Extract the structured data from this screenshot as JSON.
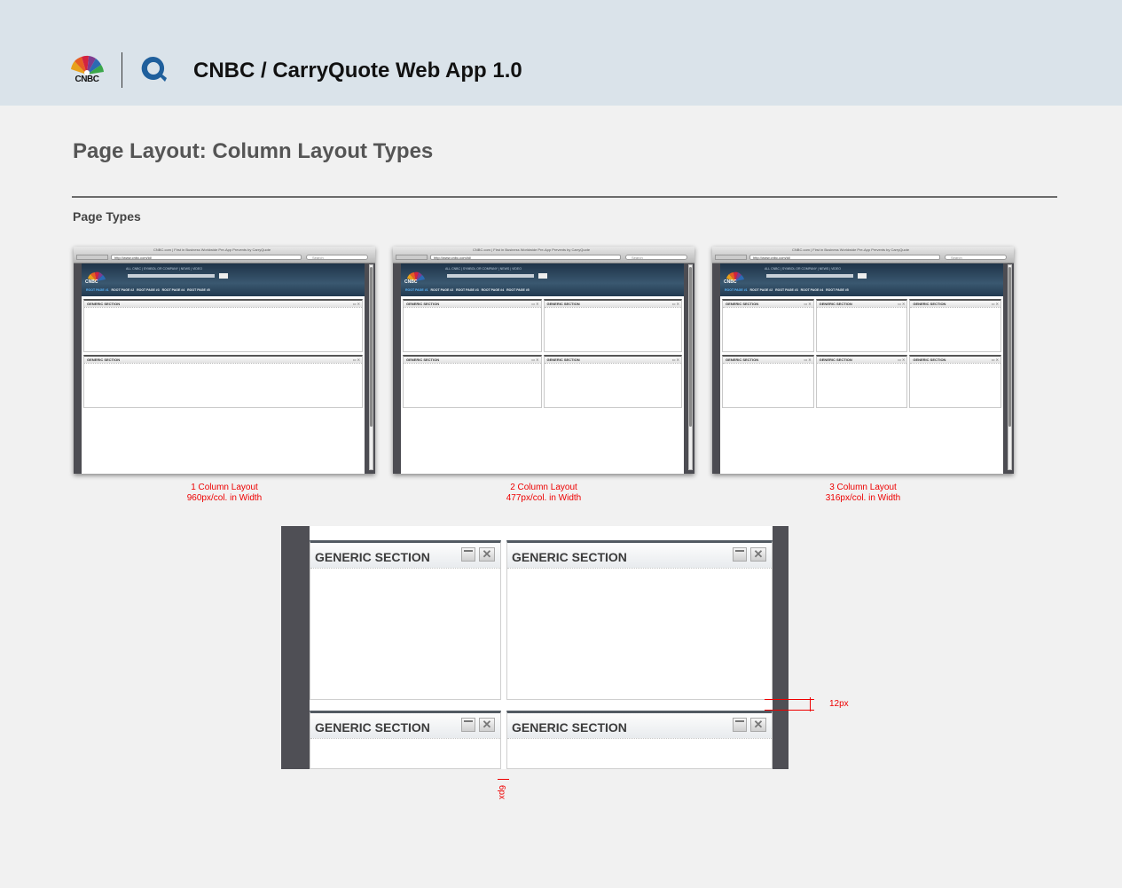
{
  "header": {
    "brand_text": "CNBC",
    "app_title": "CNBC / CarryQuote Web App 1.0",
    "accent": "#dae3ea"
  },
  "page": {
    "title": "Page Layout: Column Layout Types",
    "subtitle": "Page Types"
  },
  "thumbnail": {
    "window_title": "CNBC.com | First in Business Worldwide    Pre-App Prevents by CarryQuote",
    "url": "http://www.cnbc.com/id/",
    "search_placeholder": "Search",
    "logo_text": "CNBC",
    "top_links": "ALL CNBC  |  SYMBOL OR COMPANY  |  NEWS  |  VIDEO",
    "nav": [
      "ROOT PAGE #1",
      "ROOT PAGE #2",
      "ROOT PAGE #3",
      "ROOT PAGE #4",
      "ROOT PAGE #5"
    ],
    "section_label": "GENERIC SECTION"
  },
  "layouts": [
    {
      "name": "1 Column Layout",
      "width": "960px/col. in Width",
      "columns": 1
    },
    {
      "name": "2 Column Layout",
      "width": "477px/col. in Width",
      "columns": 2
    },
    {
      "name": "3 Column Layout",
      "width": "316px/col. in Width",
      "columns": 3
    }
  ],
  "detail": {
    "sections": [
      "GENERIC SECTION",
      "GENERIC SECTION",
      "GENERIC SECTION",
      "GENERIC SECTION"
    ],
    "vertical_gap_label": "12px",
    "horizontal_gap_label": "6px"
  },
  "colors": {
    "annotation": "#e00000",
    "panel_header": "#525a62"
  }
}
